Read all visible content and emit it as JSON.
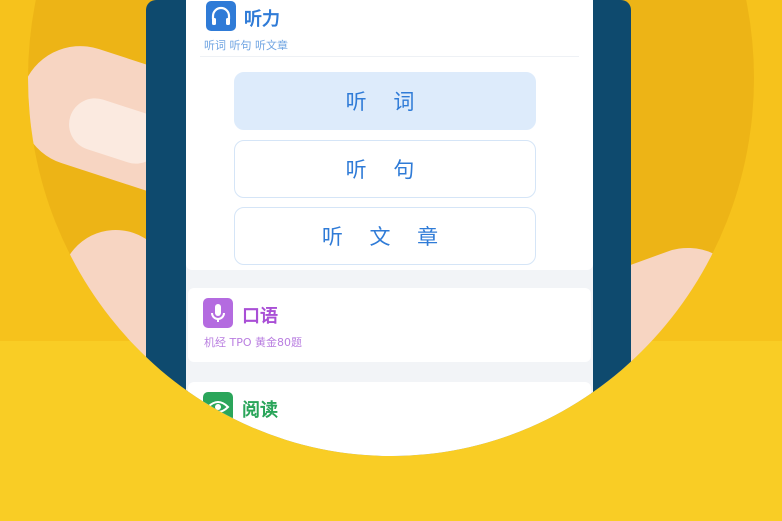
{
  "listening": {
    "title": "听力",
    "subtitle": "听词 听句 听文章",
    "icon": "headphones-icon",
    "options": [
      {
        "label": "听 词",
        "active": true
      },
      {
        "label": "听 句",
        "active": false
      },
      {
        "label": "听 文 章",
        "active": false
      }
    ]
  },
  "speaking": {
    "title": "口语",
    "subtitle": "机经 TPO 黄金80题",
    "icon": "microphone-icon"
  },
  "reading": {
    "title": "阅读",
    "icon": "eye-icon"
  },
  "colors": {
    "blue": "#2F7BD7",
    "purple": "#A94FD6",
    "green": "#2AA55A",
    "yellow": "#F6C21C"
  }
}
